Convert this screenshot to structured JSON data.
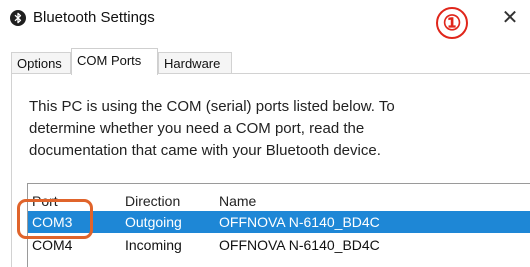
{
  "window": {
    "title": "Bluetooth Settings",
    "icon": "bluetooth-icon",
    "close_icon": "close-icon",
    "close_glyph": "✕"
  },
  "annotation": {
    "marker": "①",
    "color": "#e0261b"
  },
  "tabs": [
    {
      "label": "Options",
      "active": false
    },
    {
      "label": "COM Ports",
      "active": true
    },
    {
      "label": "Hardware",
      "active": false
    }
  ],
  "description": "This PC is using the COM (serial) ports listed below. To determine whether you need a COM port, read the documentation that came with your Bluetooth device.",
  "ports_table": {
    "columns": [
      "Port",
      "Direction",
      "Name"
    ],
    "rows": [
      {
        "port": "COM3",
        "direction": "Outgoing",
        "name": "OFFNOVA N-6140_BD4C",
        "selected": true
      },
      {
        "port": "COM4",
        "direction": "Incoming",
        "name": "OFFNOVA N-6140_BD4C",
        "selected": false
      }
    ]
  },
  "colors": {
    "selection": "#1e87d6",
    "highlight_box": "#e0642b"
  }
}
